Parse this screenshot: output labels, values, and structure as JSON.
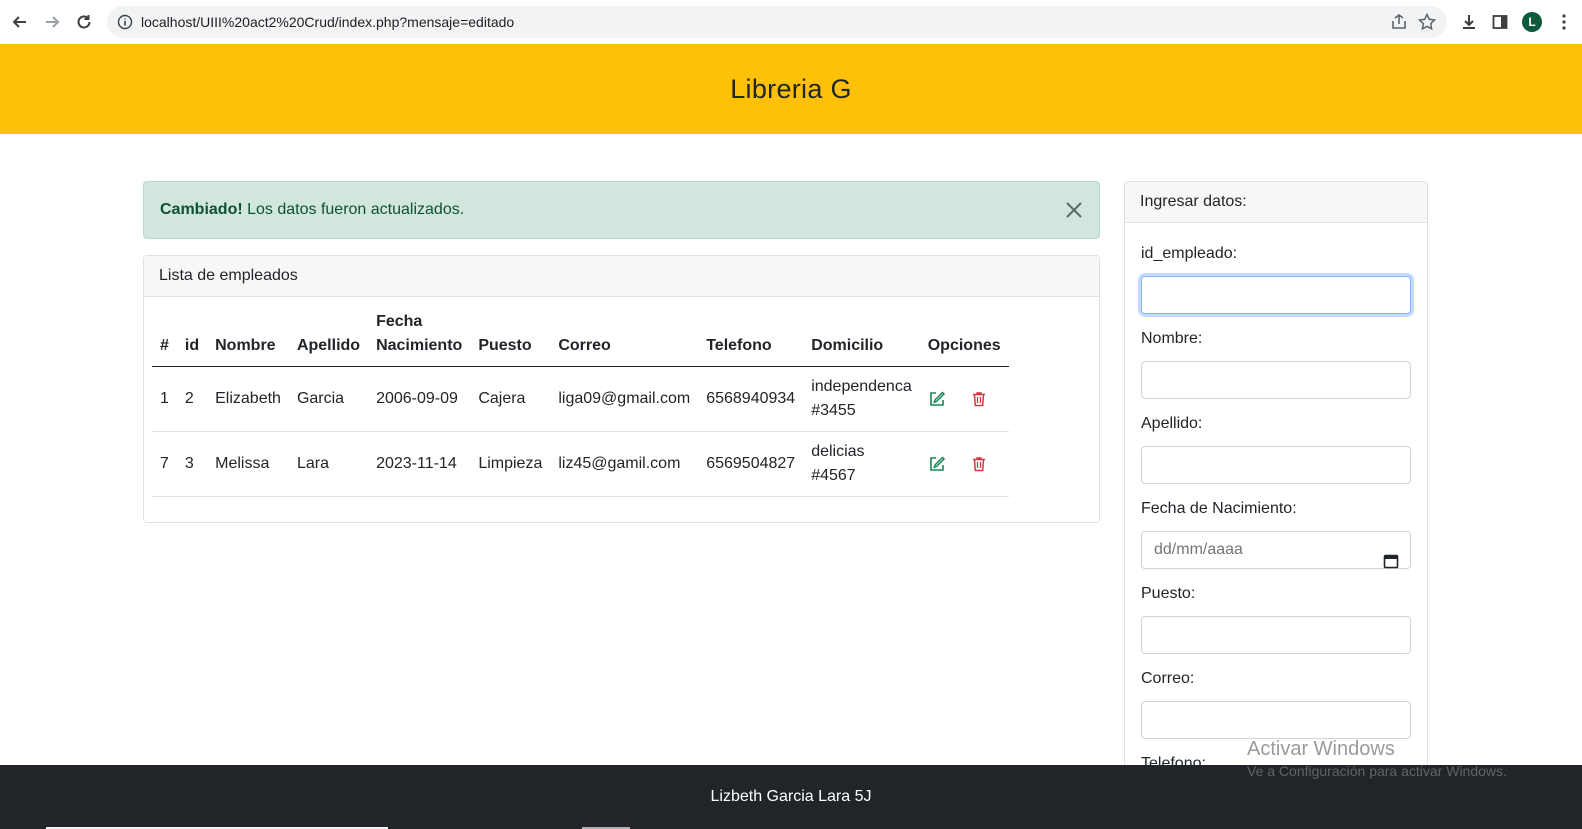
{
  "browser": {
    "url": "localhost/UIII%20act2%20Crud/index.php?mensaje=editado",
    "profile_initial": "L"
  },
  "header": {
    "title": "Libreria G",
    "bg_color": "#ffc107"
  },
  "alert": {
    "strong": "Cambiado!",
    "message": "Los datos fueron actualizados.",
    "color": "#d1e7dd"
  },
  "list": {
    "title": "Lista de empleados",
    "columns": [
      "#",
      "id",
      "Nombre",
      "Apellido",
      "Fecha Nacimiento",
      "Puesto",
      "Correo",
      "Telefono",
      "Domicilio",
      "Opciones"
    ],
    "rows": [
      {
        "num": "1",
        "id": "2",
        "nombre": "Elizabeth",
        "apellido": "Garcia",
        "fecha": "2006-09-09",
        "puesto": "Cajera",
        "correo": "liga09@gmail.com",
        "telefono": "6568940934",
        "domicilio": "independenca #3455"
      },
      {
        "num": "7",
        "id": "3",
        "nombre": "Melissa",
        "apellido": "Lara",
        "fecha": "2023-11-14",
        "puesto": "Limpieza",
        "correo": "liz45@gamil.com",
        "telefono": "6569504827",
        "domicilio": "delicias #4567"
      }
    ],
    "icons": {
      "edit": "edit-icon",
      "delete": "trash-icon"
    },
    "edit_color": "#198754",
    "delete_color": "#dc3545"
  },
  "form": {
    "title": "Ingresar datos:",
    "fields": [
      {
        "label": "id_empleado:",
        "value": ""
      },
      {
        "label": "Nombre:",
        "value": ""
      },
      {
        "label": "Apellido:",
        "value": ""
      },
      {
        "label": "Fecha de Nacimiento:",
        "value": "",
        "placeholder": "dd/mm/aaaa"
      },
      {
        "label": "Puesto:",
        "value": ""
      },
      {
        "label": "Correo:",
        "value": ""
      },
      {
        "label": "Telefono:",
        "value": ""
      }
    ]
  },
  "footer": {
    "text": "Lizbeth Garcia Lara 5J",
    "bg_color": "#212529"
  },
  "watermark": {
    "line1": "Activar Windows",
    "line2": "Ve a Configuración para activar Windows."
  }
}
